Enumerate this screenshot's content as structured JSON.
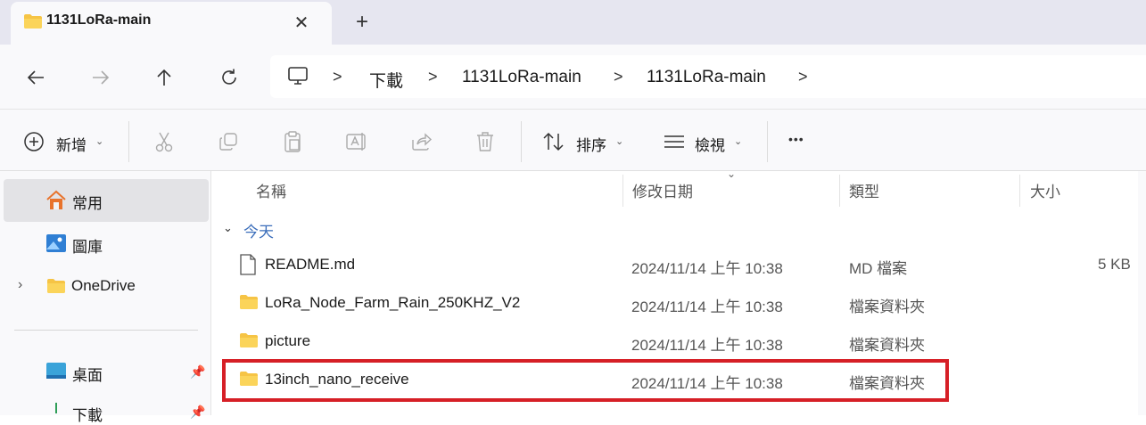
{
  "window": {
    "tab_title": "1131LoRa-main",
    "tab_close_glyph": "✕",
    "new_tab_glyph": "+"
  },
  "address_bar": {
    "breadcrumbs": [
      "下載",
      "1131LoRa-main",
      "1131LoRa-main"
    ],
    "separator": ">"
  },
  "command_bar": {
    "new_label": "新增",
    "sort_label": "排序",
    "view_label": "檢視",
    "more_glyph": "•••"
  },
  "sidebar": {
    "items": [
      {
        "label": "常用",
        "icon": "home-icon"
      },
      {
        "label": "圖庫",
        "icon": "gallery-icon"
      },
      {
        "label": "OneDrive",
        "icon": "folder-icon"
      },
      {
        "label": "桌面",
        "icon": "desktop-icon"
      },
      {
        "label": "下載",
        "icon": "download-icon"
      }
    ]
  },
  "columns": {
    "name": "名稱",
    "date": "修改日期",
    "type": "類型",
    "size": "大小"
  },
  "group": {
    "label": "今天"
  },
  "files": [
    {
      "name": "README.md",
      "date": "2024/11/14 上午 10:38",
      "type": "MD 檔案",
      "size": "5 KB",
      "icon": "file-icon"
    },
    {
      "name": "LoRa_Node_Farm_Rain_250KHZ_V2",
      "date": "2024/11/14 上午 10:38",
      "type": "檔案資料夾",
      "size": "",
      "icon": "folder-icon"
    },
    {
      "name": "picture",
      "date": "2024/11/14 上午 10:38",
      "type": "檔案資料夾",
      "size": "",
      "icon": "folder-icon"
    },
    {
      "name": "13inch_nano_receive",
      "date": "2024/11/14 上午 10:38",
      "type": "檔案資料夾",
      "size": "",
      "icon": "folder-icon"
    }
  ],
  "colors": {
    "folder": "#f6c445",
    "highlight_border": "#d61f26",
    "group_label": "#3a6dba"
  }
}
